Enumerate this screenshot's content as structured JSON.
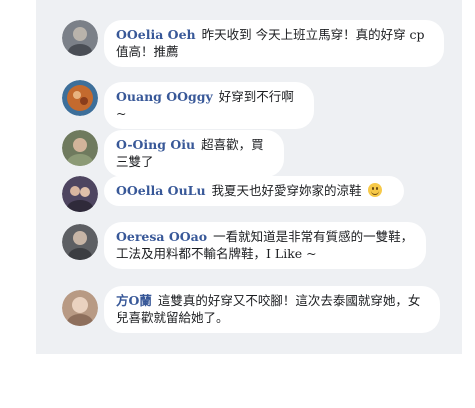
{
  "comments": [
    {
      "author": "OOelia Oeh",
      "text": "昨天收到 今天上班立馬穿！真的好穿 cp值高！推薦",
      "avatar_color": "#8a8f96"
    },
    {
      "author": "Ouang OOggy",
      "text": "好穿到不行啊~",
      "avatar_color": "#a0613a"
    },
    {
      "author": "O-Oing Oiu",
      "text": "超喜歡，買三雙了",
      "avatar_color": "#7d8a6a"
    },
    {
      "author": "OOella OuLu",
      "text": "我夏天也好愛穿妳家的涼鞋",
      "emoji": "smiling-face-icon",
      "avatar_color": "#5a4a6b"
    },
    {
      "author": "Oeresa OOao",
      "text": "一看就知道是非常有質感的一雙鞋，工法及用料都不輸名牌鞋，I Like ~",
      "avatar_color": "#5f6166"
    },
    {
      "author": "方O蘭",
      "text": "這雙真的好穿又不咬腳！這次去泰國就穿她，女兒喜歡就留給她了。",
      "avatar_color": "#c9a48a"
    }
  ]
}
